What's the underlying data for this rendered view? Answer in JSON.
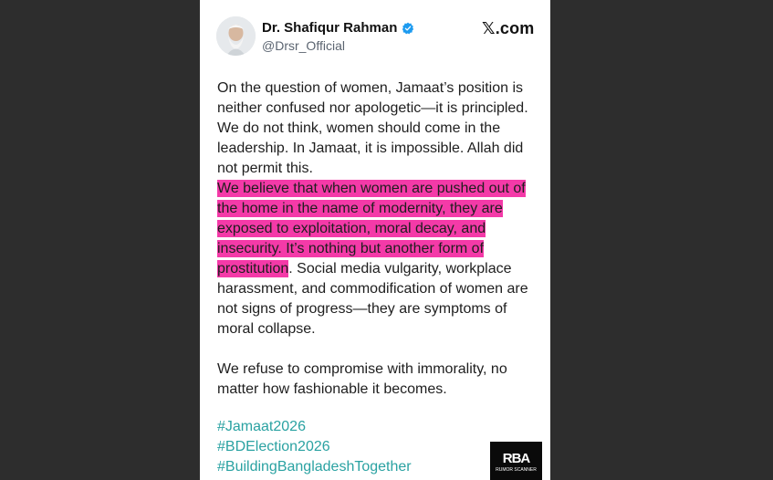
{
  "post": {
    "author": {
      "name": "Dr. Shafiqur Rahman",
      "handle": "@Drsr_Official",
      "verified": true,
      "verified_icon": "verified-badge-icon",
      "verified_color": "#1d9bf0"
    },
    "source_label": "𝕏.com",
    "text": {
      "para1_plain": "On the question of women, Jamaat’s position is neither confused nor apologetic—it is principled. We do not think, women should come in the leadership. In Jamaat, it is impossible. Allah did not permit this.",
      "para1_highlight": "We believe that when women are pushed out of the home in the name of modernity, they are exposed to exploitation, moral decay, and insecurity. It’s nothing but another form of prostitution",
      "para1_tail": ". Social media vulgarity, workplace harassment, and commodification of women are not signs of progress—they are symptoms of moral collapse.",
      "para2": "We refuse to compromise with immorality, no matter how fashionable it becomes."
    },
    "hashtags": [
      "#Jamaat2026",
      "#BDElection2026",
      "#BuildingBangladeshTogether"
    ],
    "highlight_color": "#f43aa8",
    "hashtag_color": "#2aa2a2"
  },
  "watermark": {
    "mark": "RBA",
    "sub": "RUMOR SCANNER"
  }
}
